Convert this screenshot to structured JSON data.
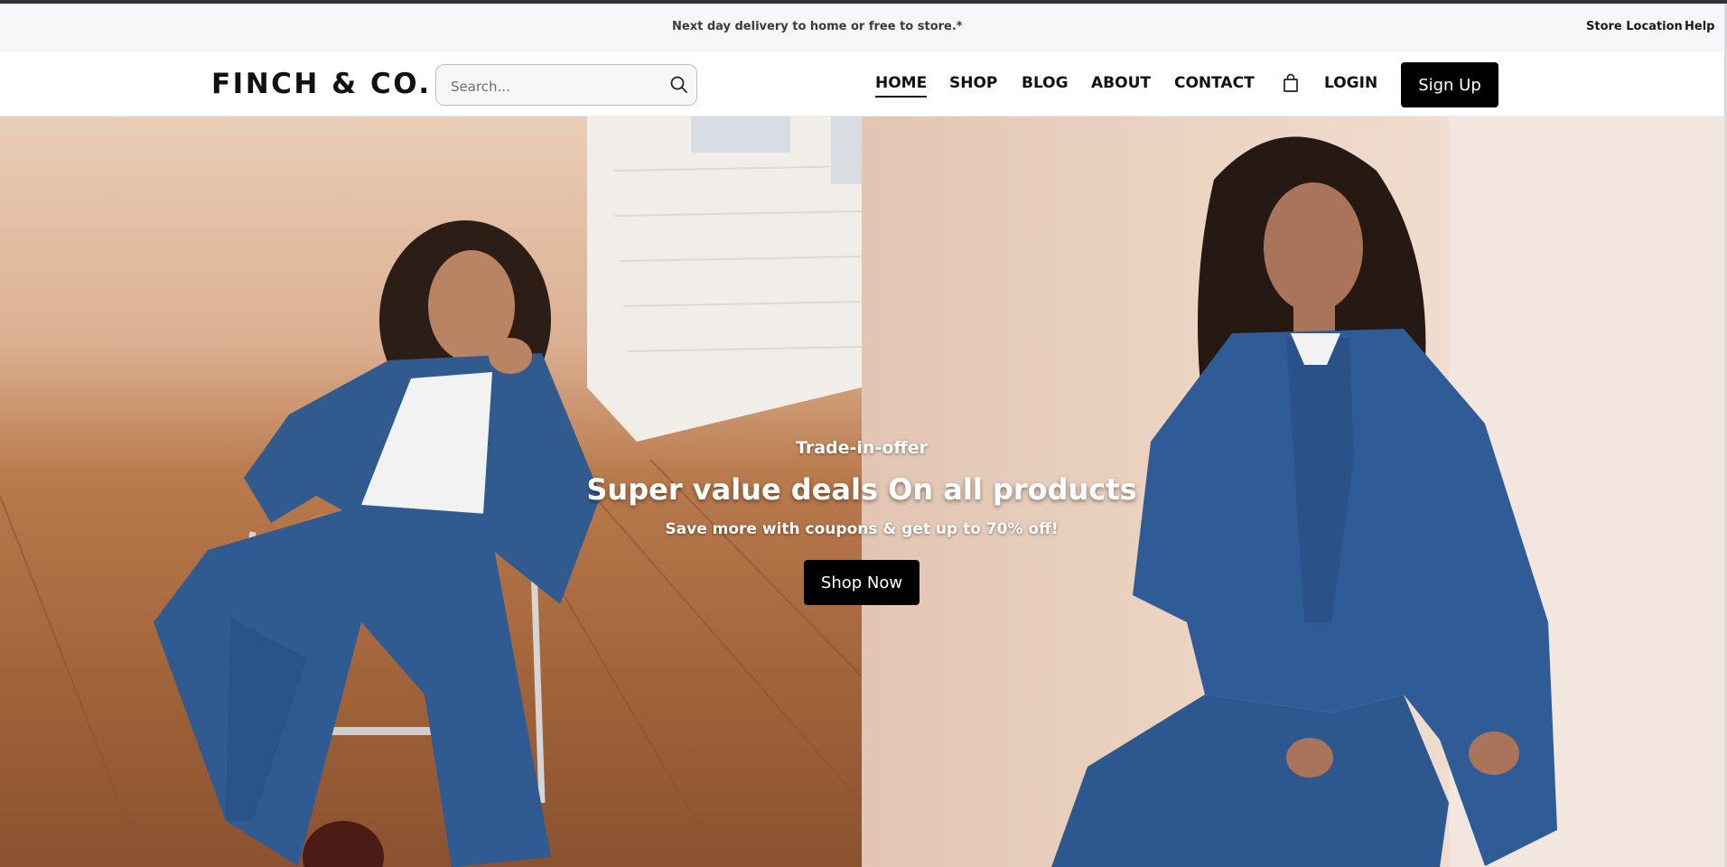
{
  "topbar": {
    "promo": "Next day delivery to home or free to store.*",
    "links": [
      "Store Location",
      "Help"
    ]
  },
  "header": {
    "logo": "FINCH & CO.",
    "search_placeholder": "Search...",
    "nav": [
      "HOME",
      "SHOP",
      "BLOG",
      "ABOUT",
      "CONTACT"
    ],
    "active_nav": "HOME",
    "login": "LOGIN",
    "signup": "Sign Up"
  },
  "hero": {
    "kicker": "Trade-in-offer",
    "headline": "Super value deals On all products",
    "subline": "Save more with coupons & get up to 70% off!",
    "cta": "Shop Now"
  },
  "icons": {
    "search": "search-icon",
    "cart": "shopping-bag-icon"
  },
  "colors": {
    "topbar_bg": "#f6f7f9",
    "button_bg": "#000000",
    "button_text": "#ffffff",
    "text": "#111111"
  }
}
